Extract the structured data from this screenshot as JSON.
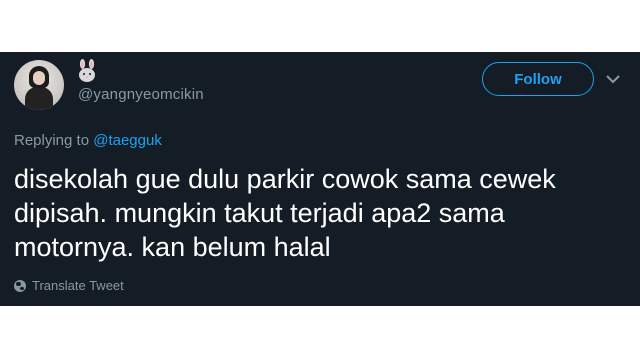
{
  "tweet": {
    "display_name_emoji": "🐰",
    "handle": "@yangnyeomcikin",
    "follow_label": "Follow",
    "replying_prefix": "Replying to ",
    "replying_to": "@taegguk",
    "text": "disekolah gue dulu parkir cowok sama cewek\ndipisah. mungkin takut terjadi apa2 sama\nmotornya. kan belum halal",
    "translate_label": "Translate Tweet"
  },
  "icons": {
    "avatar": "profile-photo",
    "display_name": "rabbit-face-icon",
    "menu": "chevron-down-icon",
    "translate": "globe-icon"
  },
  "colors": {
    "card_background": "#141d26",
    "accent": "#1da1f2",
    "secondary_text": "#8899a6",
    "primary_text": "#ffffff"
  }
}
